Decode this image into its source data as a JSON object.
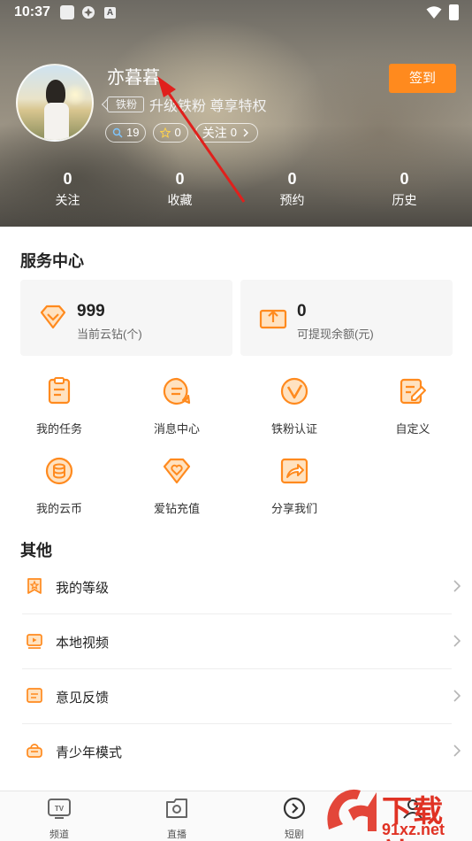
{
  "status_bar": {
    "time": "10:37",
    "a_icon_text": "A"
  },
  "profile": {
    "username": "亦暮暮.",
    "fan_tag": "铁粉",
    "fan_upgrade": "升级铁粉  尊享特权",
    "chip_search_count": "19",
    "chip_star_count": "0",
    "follow_label": "关注",
    "follow_count": "0",
    "checkin_button": "签到"
  },
  "stats": [
    {
      "value": "0",
      "label": "关注"
    },
    {
      "value": "0",
      "label": "收藏"
    },
    {
      "value": "0",
      "label": "预约"
    },
    {
      "value": "0",
      "label": "历史"
    }
  ],
  "service_center": {
    "title": "服务中心",
    "cards": [
      {
        "value": "999",
        "label": "当前云钻(个)",
        "icon": "diamond-icon"
      },
      {
        "value": "0",
        "label": "可提现余额(元)",
        "icon": "withdraw-icon"
      }
    ],
    "grid": [
      {
        "label": "我的任务",
        "icon": "task-icon"
      },
      {
        "label": "消息中心",
        "icon": "message-icon"
      },
      {
        "label": "铁粉认证",
        "icon": "fan-verify-icon"
      },
      {
        "label": "自定义",
        "icon": "edit-icon"
      },
      {
        "label": "我的云币",
        "icon": "coin-icon"
      },
      {
        "label": "爱钻充值",
        "icon": "heart-diamond-icon"
      },
      {
        "label": "分享我们",
        "icon": "share-icon"
      }
    ]
  },
  "other": {
    "title": "其他",
    "rows": [
      {
        "label": "我的等级",
        "icon": "level-icon"
      },
      {
        "label": "本地视频",
        "icon": "local-video-icon"
      },
      {
        "label": "意见反馈",
        "icon": "feedback-icon"
      },
      {
        "label": "青少年模式",
        "icon": "teen-mode-icon"
      }
    ]
  },
  "bottom_nav": [
    {
      "label": "频道",
      "icon": "tv-icon"
    },
    {
      "label": "直播",
      "icon": "live-icon"
    },
    {
      "label": "短剧",
      "icon": "play-circle-icon"
    },
    {
      "label": "",
      "icon": "profile-icon"
    }
  ],
  "watermark": {
    "brand_text": "下载站",
    "domain_text": "91xz.net"
  },
  "colors": {
    "accent": "#ff8a1e",
    "annotation_arrow": "#e0201c"
  }
}
